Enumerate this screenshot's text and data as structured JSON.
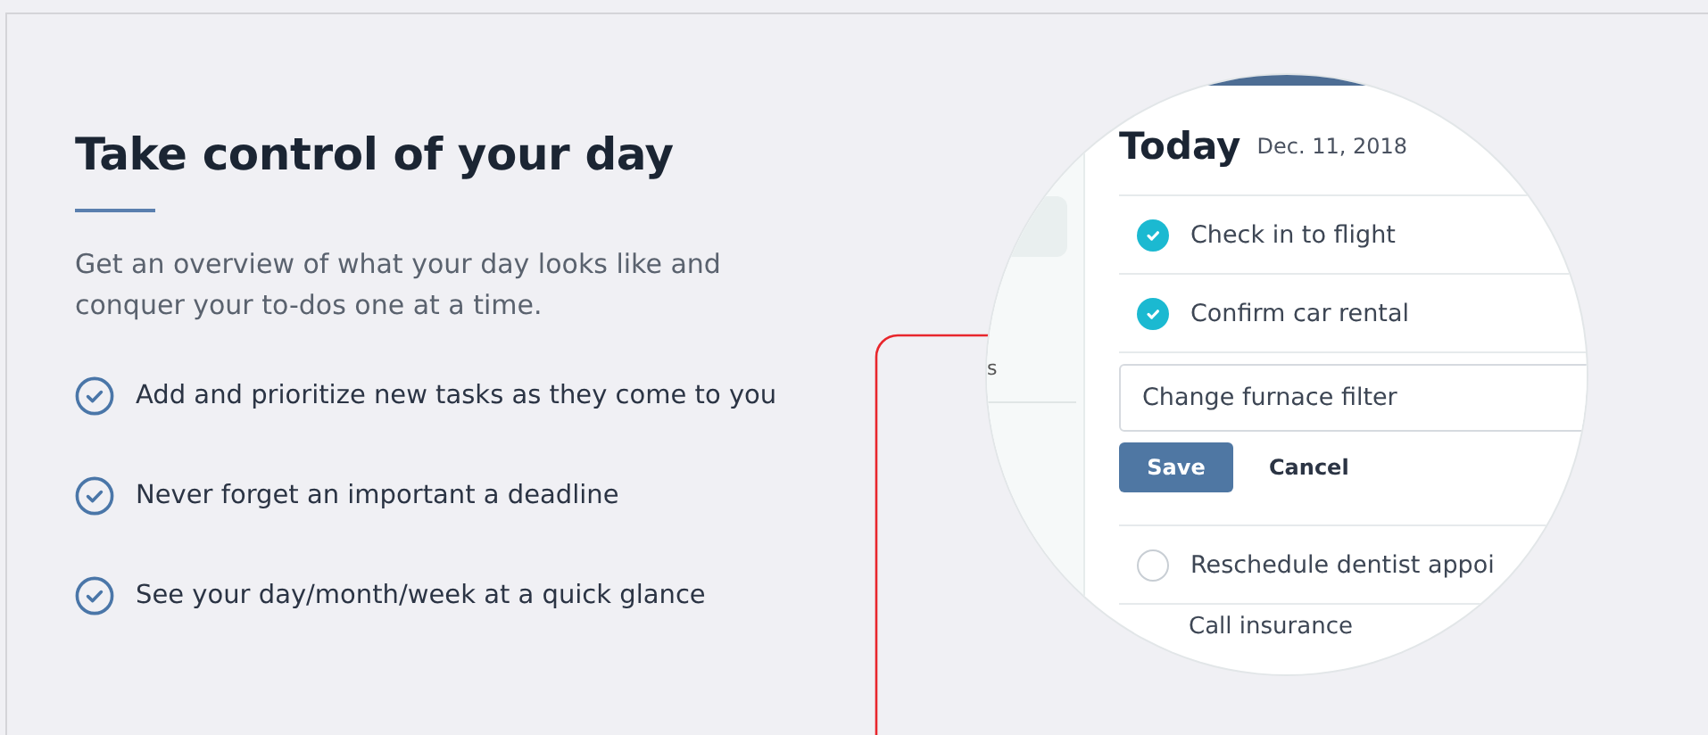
{
  "heading": "Take control of your day",
  "intro": "Get an overview of what your day looks like and conquer your to-dos one at a time.",
  "features": [
    {
      "label": "Add and prioritize new tasks as they come to you"
    },
    {
      "label": "Never forget an important a deadline"
    },
    {
      "label": "See your day/month/week at a quick glance"
    }
  ],
  "preview": {
    "sidebar_text": "s",
    "title": "Today",
    "date": "Dec. 11, 2018",
    "tasks": [
      {
        "label": "Check in to flight",
        "checked": true
      },
      {
        "label": "Confirm car rental",
        "checked": true
      }
    ],
    "editor": {
      "value": "Change furnace filter",
      "save": "Save",
      "cancel": "Cancel"
    },
    "later_tasks": [
      {
        "label": "Reschedule dentist appoi",
        "checked": false
      }
    ],
    "last_row": "Call insurance"
  }
}
